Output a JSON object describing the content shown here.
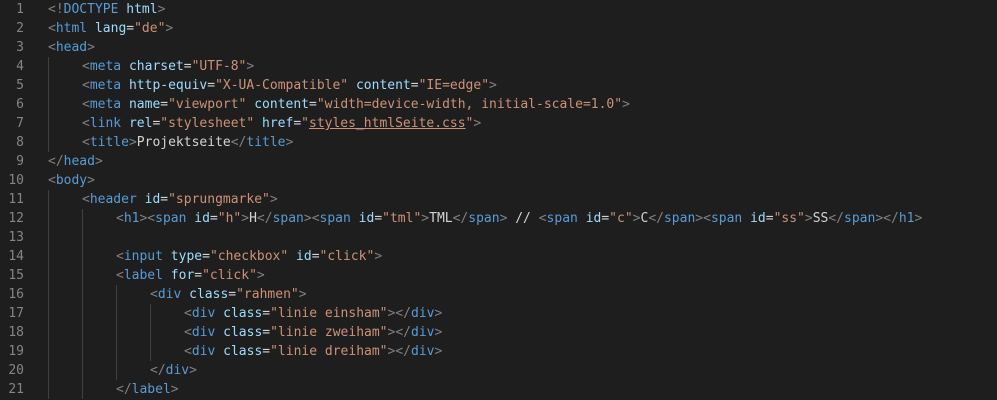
{
  "editor": {
    "theme": {
      "background": "#1e1e1e",
      "line_number": "#858585",
      "tag": "#808080",
      "tag_name": "#569cd6",
      "attribute": "#9cdcfe",
      "string": "#ce9178",
      "text": "#d4d4d4"
    },
    "lines": [
      {
        "n": "1",
        "indent": 0,
        "tokens": [
          [
            "punct",
            "<!"
          ],
          [
            "tag",
            "DOCTYPE"
          ],
          [
            "text",
            " "
          ],
          [
            "attr",
            "html"
          ],
          [
            "punct",
            ">"
          ]
        ]
      },
      {
        "n": "2",
        "indent": 0,
        "tokens": [
          [
            "punct",
            "<"
          ],
          [
            "tag",
            "html"
          ],
          [
            "text",
            " "
          ],
          [
            "attr",
            "lang"
          ],
          [
            "text",
            "="
          ],
          [
            "val",
            "\"de\""
          ],
          [
            "punct",
            ">"
          ]
        ]
      },
      {
        "n": "3",
        "indent": 0,
        "tokens": [
          [
            "punct",
            "<"
          ],
          [
            "tag",
            "head"
          ],
          [
            "punct",
            ">"
          ]
        ]
      },
      {
        "n": "4",
        "indent": 1,
        "tokens": [
          [
            "punct",
            "<"
          ],
          [
            "tag",
            "meta"
          ],
          [
            "text",
            " "
          ],
          [
            "attr",
            "charset"
          ],
          [
            "text",
            "="
          ],
          [
            "val",
            "\"UTF-8\""
          ],
          [
            "punct",
            ">"
          ]
        ]
      },
      {
        "n": "5",
        "indent": 1,
        "tokens": [
          [
            "punct",
            "<"
          ],
          [
            "tag",
            "meta"
          ],
          [
            "text",
            " "
          ],
          [
            "attr",
            "http-equiv"
          ],
          [
            "text",
            "="
          ],
          [
            "val",
            "\"X-UA-Compatible\""
          ],
          [
            "text",
            " "
          ],
          [
            "attr",
            "content"
          ],
          [
            "text",
            "="
          ],
          [
            "val",
            "\"IE=edge\""
          ],
          [
            "punct",
            ">"
          ]
        ]
      },
      {
        "n": "6",
        "indent": 1,
        "tokens": [
          [
            "punct",
            "<"
          ],
          [
            "tag",
            "meta"
          ],
          [
            "text",
            " "
          ],
          [
            "attr",
            "name"
          ],
          [
            "text",
            "="
          ],
          [
            "val",
            "\"viewport\""
          ],
          [
            "text",
            " "
          ],
          [
            "attr",
            "content"
          ],
          [
            "text",
            "="
          ],
          [
            "val",
            "\"width=device-width, initial-scale=1.0\""
          ],
          [
            "punct",
            ">"
          ]
        ]
      },
      {
        "n": "7",
        "indent": 1,
        "tokens": [
          [
            "punct",
            "<"
          ],
          [
            "tag",
            "link"
          ],
          [
            "text",
            " "
          ],
          [
            "attr",
            "rel"
          ],
          [
            "text",
            "="
          ],
          [
            "val",
            "\"stylesheet\""
          ],
          [
            "text",
            " "
          ],
          [
            "attr",
            "href"
          ],
          [
            "text",
            "="
          ],
          [
            "val",
            "\""
          ],
          [
            "link",
            "styles_htmlSeite.css"
          ],
          [
            "val",
            "\""
          ],
          [
            "punct",
            ">"
          ]
        ]
      },
      {
        "n": "8",
        "indent": 1,
        "tokens": [
          [
            "punct",
            "<"
          ],
          [
            "tag",
            "title"
          ],
          [
            "punct",
            ">"
          ],
          [
            "text",
            "Projektseite"
          ],
          [
            "punct",
            "</"
          ],
          [
            "tag",
            "title"
          ],
          [
            "punct",
            ">"
          ]
        ]
      },
      {
        "n": "9",
        "indent": 0,
        "tokens": [
          [
            "punct",
            "</"
          ],
          [
            "tag",
            "head"
          ],
          [
            "punct",
            ">"
          ]
        ]
      },
      {
        "n": "10",
        "indent": 0,
        "tokens": [
          [
            "punct",
            "<"
          ],
          [
            "tag",
            "body"
          ],
          [
            "punct",
            ">"
          ]
        ]
      },
      {
        "n": "11",
        "indent": 1,
        "tokens": [
          [
            "punct",
            "<"
          ],
          [
            "tag",
            "header"
          ],
          [
            "text",
            " "
          ],
          [
            "attr",
            "id"
          ],
          [
            "text",
            "="
          ],
          [
            "val",
            "\"sprungmarke\""
          ],
          [
            "punct",
            ">"
          ]
        ]
      },
      {
        "n": "12",
        "indent": 2,
        "tokens": [
          [
            "punct",
            "<"
          ],
          [
            "tag",
            "h1"
          ],
          [
            "punct",
            "><"
          ],
          [
            "tag",
            "span"
          ],
          [
            "text",
            " "
          ],
          [
            "attr",
            "id"
          ],
          [
            "text",
            "="
          ],
          [
            "val",
            "\"h\""
          ],
          [
            "punct",
            ">"
          ],
          [
            "text",
            "H"
          ],
          [
            "punct",
            "</"
          ],
          [
            "tag",
            "span"
          ],
          [
            "punct",
            "><"
          ],
          [
            "tag",
            "span"
          ],
          [
            "text",
            " "
          ],
          [
            "attr",
            "id"
          ],
          [
            "text",
            "="
          ],
          [
            "val",
            "\"tml\""
          ],
          [
            "punct",
            ">"
          ],
          [
            "text",
            "TML"
          ],
          [
            "punct",
            "</"
          ],
          [
            "tag",
            "span"
          ],
          [
            "punct",
            ">"
          ],
          [
            "text",
            " // "
          ],
          [
            "punct",
            "<"
          ],
          [
            "tag",
            "span"
          ],
          [
            "text",
            " "
          ],
          [
            "attr",
            "id"
          ],
          [
            "text",
            "="
          ],
          [
            "val",
            "\"c\""
          ],
          [
            "punct",
            ">"
          ],
          [
            "text",
            "C"
          ],
          [
            "punct",
            "</"
          ],
          [
            "tag",
            "span"
          ],
          [
            "punct",
            "><"
          ],
          [
            "tag",
            "span"
          ],
          [
            "text",
            " "
          ],
          [
            "attr",
            "id"
          ],
          [
            "text",
            "="
          ],
          [
            "val",
            "\"ss\""
          ],
          [
            "punct",
            ">"
          ],
          [
            "text",
            "SS"
          ],
          [
            "punct",
            "</"
          ],
          [
            "tag",
            "span"
          ],
          [
            "punct",
            "></"
          ],
          [
            "tag",
            "h1"
          ],
          [
            "punct",
            ">"
          ]
        ]
      },
      {
        "n": "13",
        "indent": 2,
        "tokens": []
      },
      {
        "n": "14",
        "indent": 2,
        "tokens": [
          [
            "punct",
            "<"
          ],
          [
            "tag",
            "input"
          ],
          [
            "text",
            " "
          ],
          [
            "attr",
            "type"
          ],
          [
            "text",
            "="
          ],
          [
            "val",
            "\"checkbox\""
          ],
          [
            "text",
            " "
          ],
          [
            "attr",
            "id"
          ],
          [
            "text",
            "="
          ],
          [
            "val",
            "\"click\""
          ],
          [
            "punct",
            ">"
          ]
        ]
      },
      {
        "n": "15",
        "indent": 2,
        "tokens": [
          [
            "punct",
            "<"
          ],
          [
            "tag",
            "label"
          ],
          [
            "text",
            " "
          ],
          [
            "attr",
            "for"
          ],
          [
            "text",
            "="
          ],
          [
            "val",
            "\"click\""
          ],
          [
            "punct",
            ">"
          ]
        ]
      },
      {
        "n": "16",
        "indent": 3,
        "tokens": [
          [
            "punct",
            "<"
          ],
          [
            "tag",
            "div"
          ],
          [
            "text",
            " "
          ],
          [
            "attr",
            "class"
          ],
          [
            "text",
            "="
          ],
          [
            "val",
            "\"rahmen\""
          ],
          [
            "punct",
            ">"
          ]
        ]
      },
      {
        "n": "17",
        "indent": 4,
        "tokens": [
          [
            "punct",
            "<"
          ],
          [
            "tag",
            "div"
          ],
          [
            "text",
            " "
          ],
          [
            "attr",
            "class"
          ],
          [
            "text",
            "="
          ],
          [
            "val",
            "\"linie einsham\""
          ],
          [
            "punct",
            "></"
          ],
          [
            "tag",
            "div"
          ],
          [
            "punct",
            ">"
          ]
        ]
      },
      {
        "n": "18",
        "indent": 4,
        "tokens": [
          [
            "punct",
            "<"
          ],
          [
            "tag",
            "div"
          ],
          [
            "text",
            " "
          ],
          [
            "attr",
            "class"
          ],
          [
            "text",
            "="
          ],
          [
            "val",
            "\"linie zweiham\""
          ],
          [
            "punct",
            "></"
          ],
          [
            "tag",
            "div"
          ],
          [
            "punct",
            ">"
          ]
        ]
      },
      {
        "n": "19",
        "indent": 4,
        "tokens": [
          [
            "punct",
            "<"
          ],
          [
            "tag",
            "div"
          ],
          [
            "text",
            " "
          ],
          [
            "attr",
            "class"
          ],
          [
            "text",
            "="
          ],
          [
            "val",
            "\"linie dreiham\""
          ],
          [
            "punct",
            "></"
          ],
          [
            "tag",
            "div"
          ],
          [
            "punct",
            ">"
          ]
        ]
      },
      {
        "n": "20",
        "indent": 3,
        "tokens": [
          [
            "punct",
            "</"
          ],
          [
            "tag",
            "div"
          ],
          [
            "punct",
            ">"
          ]
        ]
      },
      {
        "n": "21",
        "indent": 2,
        "tokens": [
          [
            "punct",
            "</"
          ],
          [
            "tag",
            "label"
          ],
          [
            "punct",
            ">"
          ]
        ]
      }
    ]
  }
}
